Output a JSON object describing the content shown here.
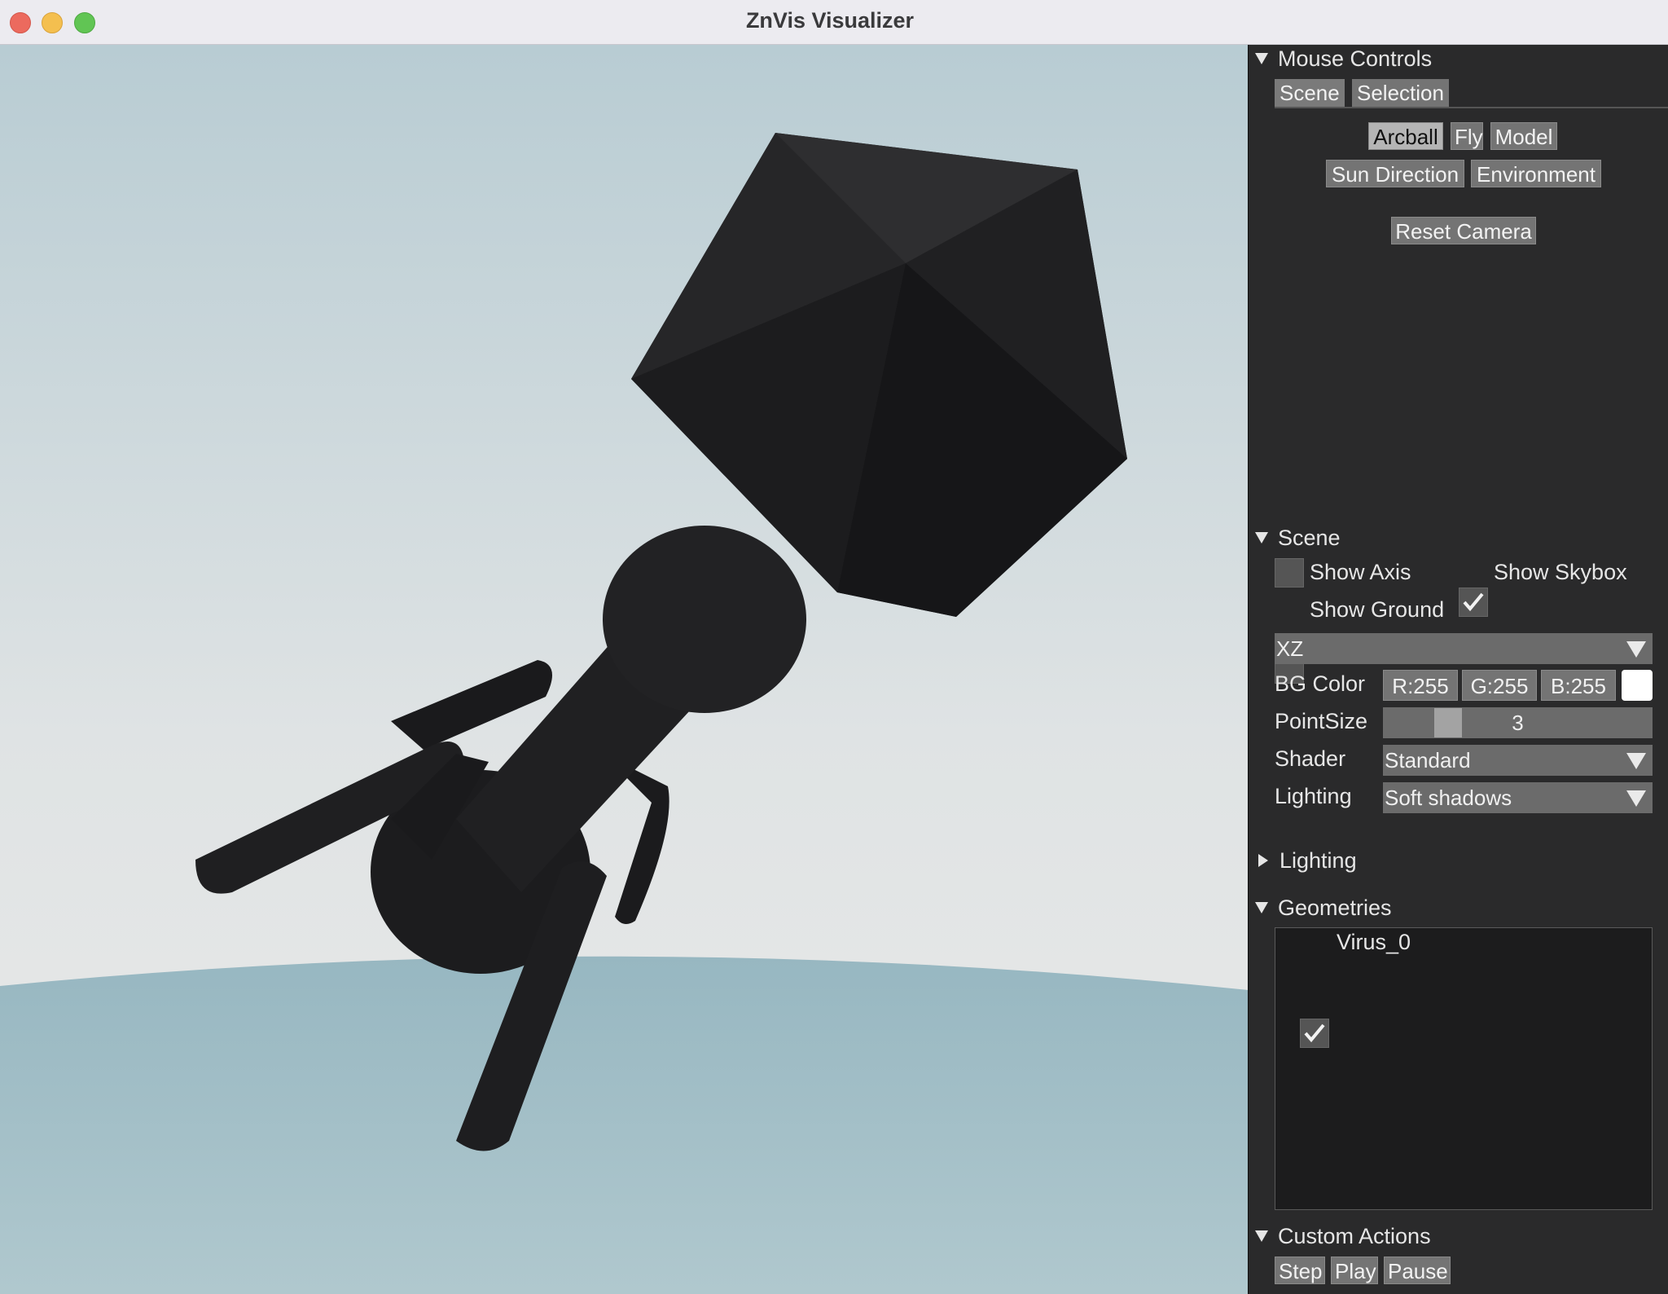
{
  "window": {
    "title": "ZnVis Visualizer"
  },
  "mouse_controls": {
    "header": "Mouse Controls",
    "tabs": [
      "Scene",
      "Selection"
    ],
    "modes": [
      "Arcball",
      "Fly",
      "Model"
    ],
    "selected_mode": "Arcball",
    "modes2": [
      "Sun Direction",
      "Environment"
    ],
    "reset_label": "Reset Camera"
  },
  "scene": {
    "header": "Scene",
    "show_axis": {
      "label": "Show Axis",
      "checked": false
    },
    "show_skybox": {
      "label": "Show Skybox",
      "checked": true
    },
    "show_ground": {
      "label": "Show Ground",
      "checked": false
    },
    "plane_select": "XZ",
    "bg_color": {
      "label": "BG Color",
      "r": "R:255",
      "g": "G:255",
      "b": "B:255",
      "swatch": "#ffffff"
    },
    "point_size": {
      "label": "PointSize",
      "value": "3"
    },
    "shader": {
      "label": "Shader",
      "value": "Standard"
    },
    "lighting": {
      "label": "Lighting",
      "value": "Soft shadows"
    }
  },
  "lighting_section": {
    "header": "Lighting",
    "expanded": false
  },
  "geometries": {
    "header": "Geometries",
    "items": [
      {
        "label": "Virus_0",
        "checked": true
      }
    ]
  },
  "custom_actions": {
    "header": "Custom Actions",
    "buttons": [
      "Step",
      "Play",
      "Pause"
    ]
  },
  "colors": {
    "panel_bg": "#2a2a2b",
    "sky_top": "#b9cdd4",
    "ground": "#9ebcc6",
    "model": "#1e1e20"
  }
}
